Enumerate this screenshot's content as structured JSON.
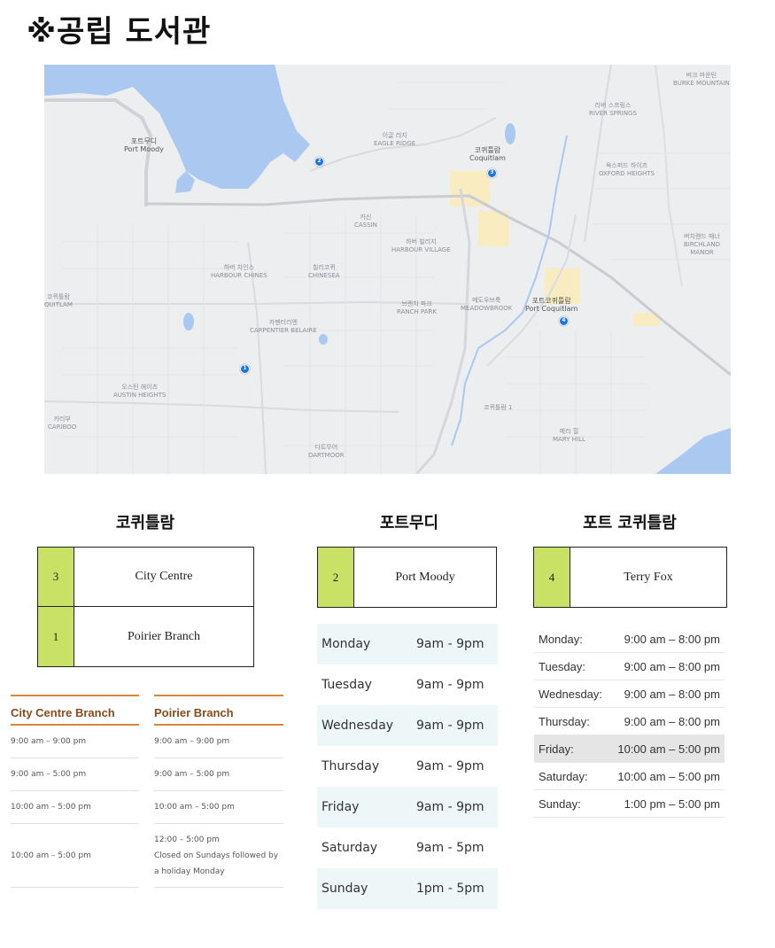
{
  "title": "※공립 도서관",
  "map": {
    "labels": [
      {
        "text": "포트무디",
        "text2": "Port Moody",
        "big": true
      },
      {
        "text": "코퀴틀람",
        "text2": "Coquitlam",
        "big": true
      },
      {
        "text": "포트코퀴틀람",
        "text2": "Port Coquitlam",
        "big": true
      },
      {
        "text": "이글 리지",
        "text2": "EAGLE RIDGE"
      },
      {
        "text": "카신",
        "text2": "CASSIN"
      },
      {
        "text": "하버 빌리지",
        "text2": "HARBOUR VILLAGE"
      },
      {
        "text": "하버 차인스",
        "text2": "HARBOUR CHINES"
      },
      {
        "text": "칠리코퀴",
        "text2": "CHINESEA"
      },
      {
        "text": "브랜치 파크",
        "text2": "RANCH PARK"
      },
      {
        "text": "메도우브룩",
        "text2": "MEADOWBROOK"
      },
      {
        "text": "카펜터리엔",
        "text2": "CARPENTIER BELAIRE"
      },
      {
        "text": "오스틴 헤이츠",
        "text2": "AUSTIN HEIGHTS"
      },
      {
        "text": "카리부",
        "text2": "CARIBOO"
      },
      {
        "text": "다트무어",
        "text2": "DARTMOOR"
      },
      {
        "text": "메리 힐",
        "text2": "MARY HILL"
      },
      {
        "text": "리버 스프링스",
        "text2": "RIVER SPRINGS"
      },
      {
        "text": "옥스퍼드 하이츠",
        "text2": "OXFORD HEIGHTS"
      },
      {
        "text": "버치랜드 매너",
        "text2": "BIRCHLAND MANOR"
      },
      {
        "text": "버크 마운틴",
        "text2": "BURKE MOUNTAIN"
      },
      {
        "text": "코퀴틀람",
        "text2": "QUITLAM"
      },
      {
        "text": "코퀴틀람 1",
        "text2": ""
      }
    ],
    "markers": [
      "2",
      "3",
      "1",
      "4"
    ]
  },
  "columns": {
    "coquitlam": {
      "title": "코퀴틀람",
      "branches": [
        {
          "num": "3",
          "name": "City Centre"
        },
        {
          "num": "1",
          "name": "Poirier Branch"
        }
      ],
      "city_centre": {
        "heading": "City Centre Branch",
        "rows": [
          "9:00 am – 9:00 pm",
          "9:00 am – 5:00 pm",
          "10:00 am – 5:00 pm",
          "10:00 am – 5:00 pm"
        ]
      },
      "poirier": {
        "heading": "Poirier Branch",
        "rows": [
          "9:00 am – 9:00 pm",
          "9:00 am – 5:00 pm",
          "10:00 am – 5:00 pm"
        ],
        "last_line1": "12:00 – 5:00 pm",
        "last_line2": "Closed on Sundays followed by a holiday Monday"
      }
    },
    "port_moody": {
      "title": "포트무디",
      "branch": {
        "num": "2",
        "name": "Port Moody"
      },
      "hours": [
        {
          "day": "Monday",
          "time": "9am - 9pm"
        },
        {
          "day": "Tuesday",
          "time": "9am - 9pm"
        },
        {
          "day": "Wednesday",
          "time": "9am - 9pm"
        },
        {
          "day": "Thursday",
          "time": "9am - 9pm"
        },
        {
          "day": "Friday",
          "time": "9am - 9pm"
        },
        {
          "day": "Saturday",
          "time": "9am - 5pm"
        },
        {
          "day": "Sunday",
          "time": "1pm - 5pm"
        }
      ]
    },
    "port_coquitlam": {
      "title": "포트 코퀴틀람",
      "branch": {
        "num": "4",
        "name": "Terry Fox"
      },
      "hours": [
        {
          "day": "Monday:",
          "time": "9:00 am – 8:00 pm"
        },
        {
          "day": "Tuesday:",
          "time": "9:00 am – 8:00 pm"
        },
        {
          "day": "Wednesday:",
          "time": "9:00 am – 8:00 pm"
        },
        {
          "day": "Thursday:",
          "time": "9:00 am – 8:00 pm"
        },
        {
          "day": "Friday:",
          "time": "10:00 am – 5:00 pm"
        },
        {
          "day": "Saturday:",
          "time": "10:00 am – 5:00 pm"
        },
        {
          "day": "Sunday:",
          "time": "1:00 pm – 5:00 pm"
        }
      ]
    }
  },
  "colors": {
    "accent_green": "#c9e265",
    "accent_orange": "#d4893a",
    "water": "#aac8f0",
    "marker": "#1a73e8"
  }
}
